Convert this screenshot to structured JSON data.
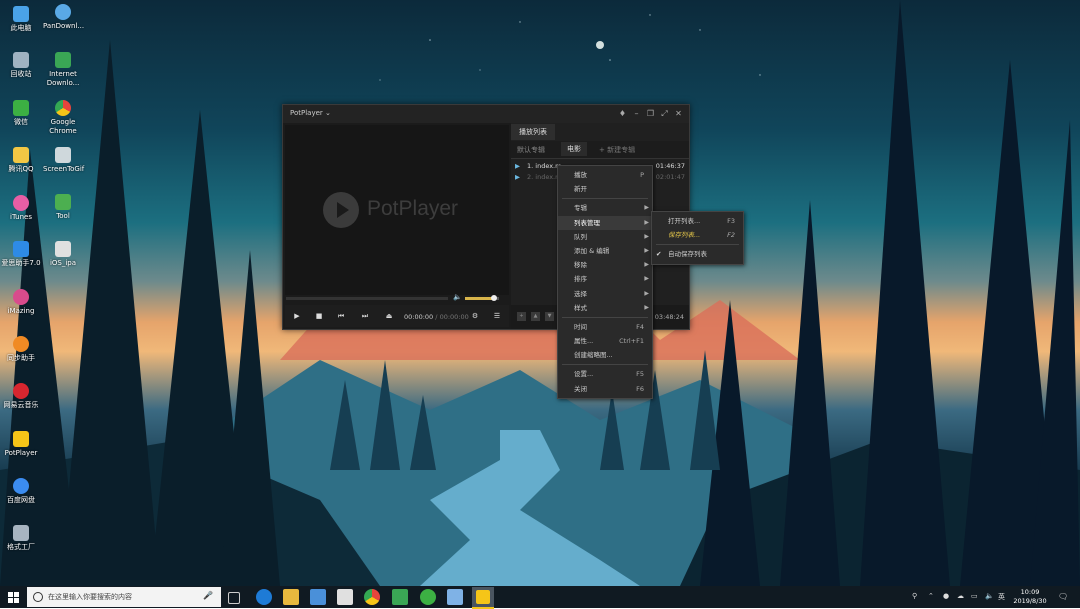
{
  "desktop": {
    "icons": [
      {
        "label": "此电脑",
        "color": "#4aa3e8"
      },
      {
        "label": "回收站",
        "color": "#9fb3c2"
      },
      {
        "label": "微信",
        "color": "#3cb043"
      },
      {
        "label": "腾讯QQ",
        "color": "#f2c744"
      },
      {
        "label": "iTunes",
        "color": "#e85ea5"
      },
      {
        "label": "爱思助手7.0",
        "color": "#2e8be6"
      },
      {
        "label": "iMazing",
        "color": "#d84b8c"
      },
      {
        "label": "同步助手",
        "color": "#f08a24"
      },
      {
        "label": "网易云音乐",
        "color": "#d8262f"
      },
      {
        "label": "PotPlayer",
        "color": "#f5c518"
      },
      {
        "label": "百度网盘",
        "color": "#3b8cf0"
      },
      {
        "label": "格式工厂",
        "color": "#a7b4c0"
      },
      {
        "label": "PanDownl...",
        "color": "#5aa9e6"
      },
      {
        "label": "Internet Downlo...",
        "color": "#3aa655"
      },
      {
        "label": "Google Chrome",
        "color": "#e8b030"
      },
      {
        "label": "ScreenToGif",
        "color": "#cfd8dc"
      },
      {
        "label": "Tool",
        "color": "#4caf50"
      },
      {
        "label": "iOS_ipa",
        "color": "#e0e0e0"
      }
    ]
  },
  "potplayer": {
    "title": "PotPlayer",
    "logo_text": "PotPlayer",
    "time_current": "00:00:00",
    "time_separator": "/",
    "time_total": "00:00:00",
    "volume_level": 0.85,
    "playlist": {
      "tab_label": "播放列表",
      "sub_default": "默认专辑",
      "sub_movie": "电影",
      "sub_new": "+ 新建专辑",
      "rows": [
        {
          "name": "1. index.m...",
          "duration": "01:46:37"
        },
        {
          "name": "2. index.m...",
          "duration": "02:01:47"
        }
      ],
      "total_duration": "03:48:24"
    }
  },
  "context_menu": {
    "items": [
      {
        "label": "播放",
        "shortcut": "P"
      },
      {
        "label": "新开",
        "shortcut": ""
      },
      {
        "label": "专辑",
        "submenu": true
      },
      {
        "label": "列表管理",
        "submenu": true,
        "highlighted": true
      },
      {
        "label": "队列",
        "submenu": true
      },
      {
        "label": "添加 & 编辑",
        "submenu": true
      },
      {
        "label": "移除",
        "submenu": true
      },
      {
        "label": "排序",
        "submenu": true
      },
      {
        "label": "选择",
        "submenu": true
      },
      {
        "label": "样式",
        "submenu": true
      },
      {
        "label": "时间",
        "shortcut": "F4"
      },
      {
        "label": "属性...",
        "shortcut": "Ctrl+F1"
      },
      {
        "label": "创建缩略图...",
        "shortcut": ""
      },
      {
        "label": "设置...",
        "shortcut": "F5"
      },
      {
        "label": "关闭",
        "shortcut": "F6"
      }
    ],
    "submenu": [
      {
        "label": "打开列表...",
        "shortcut": "F3"
      },
      {
        "label": "保存列表...",
        "shortcut": "F2"
      },
      {
        "label": "自动保存列表",
        "shortcut": ""
      }
    ]
  },
  "taskbar": {
    "search_placeholder": "在这里输入你要搜索的内容",
    "ime": "英",
    "time": "10:09",
    "date": "2019/8/30",
    "accent": "#f5c518"
  }
}
